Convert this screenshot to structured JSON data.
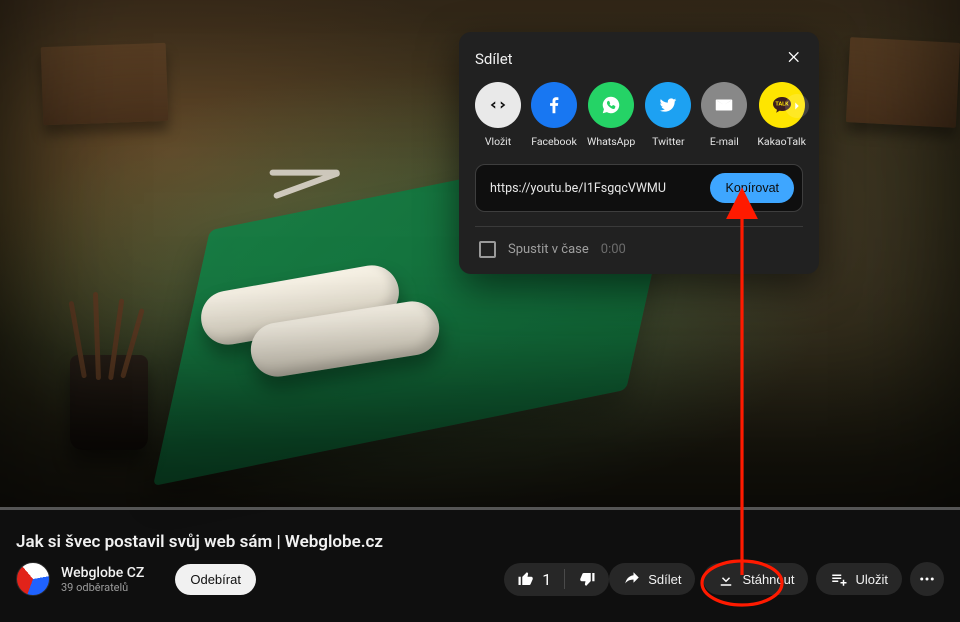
{
  "share": {
    "title": "Sdílet",
    "url": "https://youtu.be/I1FsgqcVWMU",
    "copy_label": "Kopírovat",
    "start_at_label": "Spustit v čase",
    "start_at_time": "0:00",
    "options": [
      {
        "id": "embed",
        "label": "Vložit"
      },
      {
        "id": "facebook",
        "label": "Facebook"
      },
      {
        "id": "whatsapp",
        "label": "WhatsApp"
      },
      {
        "id": "twitter",
        "label": "Twitter"
      },
      {
        "id": "email",
        "label": "E-mail"
      },
      {
        "id": "kakao",
        "label": "KakaoTalk"
      }
    ]
  },
  "video": {
    "title": "Jak si švec postavil svůj web sám | Webglobe.cz",
    "channel_name": "Webglobe CZ",
    "subscribers": "39 odběratelů",
    "subscribe_label": "Odebírat",
    "like_count": "1",
    "share_label": "Sdílet",
    "download_label": "Stáhnout",
    "save_label": "Uložit"
  },
  "colors": {
    "facebook": "#1877f2",
    "whatsapp": "#25d366",
    "twitter": "#1da1f2",
    "email": "#888888",
    "kakao": "#fee500",
    "accent": "#3ea6ff",
    "annotation": "#ff1a00"
  }
}
